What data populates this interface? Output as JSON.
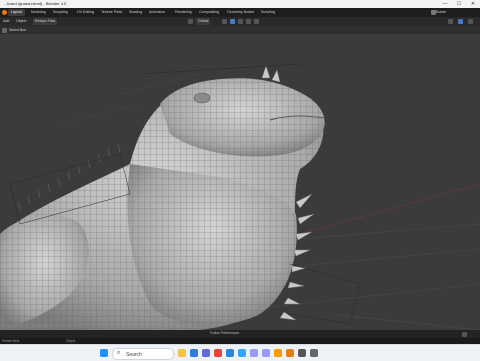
{
  "window": {
    "title": "...lizard Iguana.blend] - Blender 4.0",
    "minimize": "—",
    "maximize": "☐",
    "close": "✕"
  },
  "workspaces": {
    "file_icon": "blender-logo",
    "tabs": [
      "Layout",
      "Modeling",
      "Sculpting",
      "UV Editing",
      "Texture Paint",
      "Shading",
      "Animation",
      "Rendering",
      "Compositing",
      "Geometry Nodes",
      "Scripting"
    ],
    "active": "Layout",
    "scene_label": "Scene"
  },
  "toolbar": {
    "menu": [
      "Add",
      "Object"
    ],
    "retopo_label": "Retopo Flow",
    "transform_orientation": "Global"
  },
  "subbar": {
    "select_mode": "Select Box"
  },
  "viewport": {
    "mesh_color": "#bdbdbd",
    "wire_color": "#5c5c5c"
  },
  "footer": {
    "follow_prefs": "Follow Preferences"
  },
  "status": {
    "rotate_view": "Rotate View",
    "object_label": "Object"
  },
  "taskbar": {
    "search_placeholder": "Search",
    "apps": [
      "file-explorer-icon",
      "edge-icon",
      "store-icon",
      "chrome-icon",
      "mail-icon",
      "photoshop-icon",
      "premiere-icon",
      "after-effects-icon",
      "illustrator-icon",
      "blender-icon",
      "zbrush-icon",
      "app-icon"
    ]
  }
}
